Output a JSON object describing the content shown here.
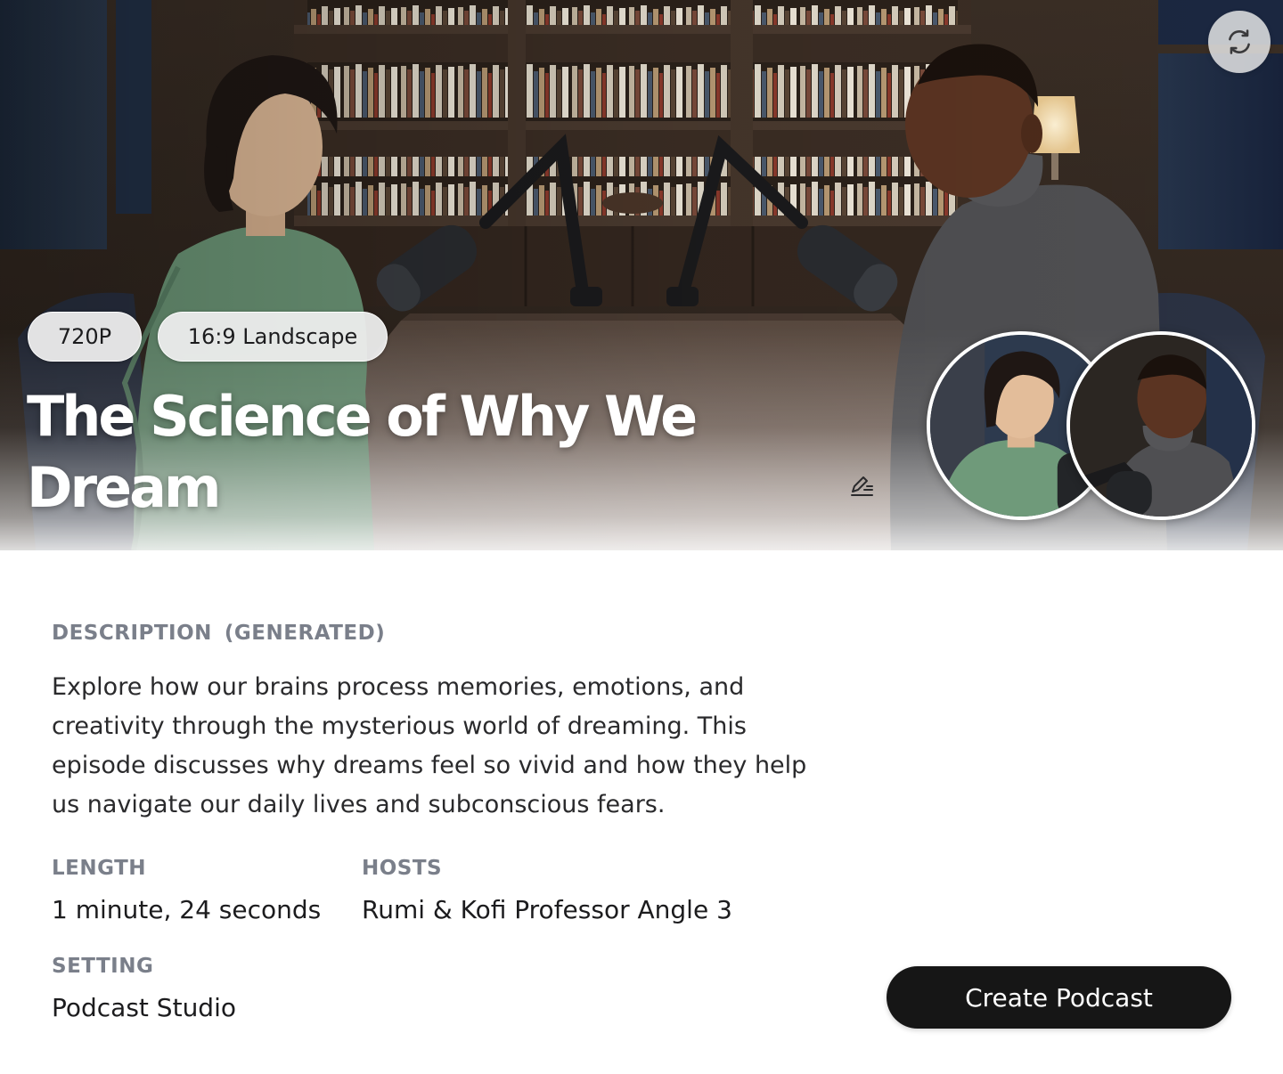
{
  "hero": {
    "resolution_badge": "720P",
    "aspect_badge": "16:9 Landscape",
    "title": "The Science of Why We Dream",
    "refresh_icon": "refresh-icon",
    "edit_icon": "edit-icon"
  },
  "hosts_avatars": [
    {
      "name": "Rumi"
    },
    {
      "name": "Kofi"
    }
  ],
  "details": {
    "description_label": "DESCRIPTION",
    "description_tag": "(GENERATED)",
    "description_text": "Explore how our brains process memories, emotions, and creativity through the mysterious world of dreaming. This episode discusses why dreams feel so vivid and how they help us navigate our daily lives and subconscious fears.",
    "length_label": "LENGTH",
    "length_value": "1 minute, 24 seconds",
    "hosts_label": "HOSTS",
    "hosts_value": "Rumi & Kofi Professor Angle 3",
    "setting_label": "SETTING",
    "setting_value": "Podcast Studio"
  },
  "actions": {
    "create_label": "Create Podcast"
  },
  "colors": {
    "label_gray": "#7a7f8a",
    "button_bg": "#161616",
    "button_text": "#ffffff"
  }
}
